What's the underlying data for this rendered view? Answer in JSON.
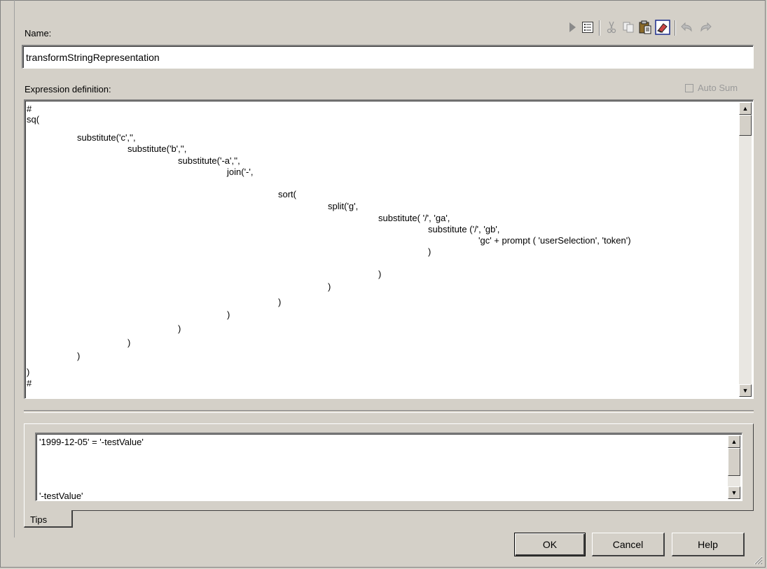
{
  "name_label": "Name:",
  "name_value": "transformStringRepresentation",
  "expression_label": "Expression definition:",
  "auto_sum_label": "Auto Sum",
  "toolbar": {
    "icons": [
      "run-icon",
      "properties-list-icon",
      "cut-icon",
      "copy-icon",
      "paste-icon",
      "erase-icon",
      "undo-icon",
      "redo-icon"
    ]
  },
  "expression": {
    "lines": [
      "#",
      "sq(",
      "substitute('c','',",
      "substitute('b','',",
      "substitute('-a','',",
      "join('-',",
      "sort(",
      "split('g',",
      "substitute( '/', 'ga',",
      "substitute ('/', 'gb',",
      "'gc' + prompt ( 'userSelection', 'token')",
      ")",
      ")",
      ")",
      ")",
      ")",
      ")",
      ")",
      ")",
      ")",
      "#"
    ]
  },
  "tips": {
    "line1": "'1999-12-05' =   '-testValue'",
    "line2": "'-testValue'",
    "tab_label": "Tips"
  },
  "buttons": {
    "ok": "OK",
    "cancel": "Cancel",
    "help": "Help"
  }
}
